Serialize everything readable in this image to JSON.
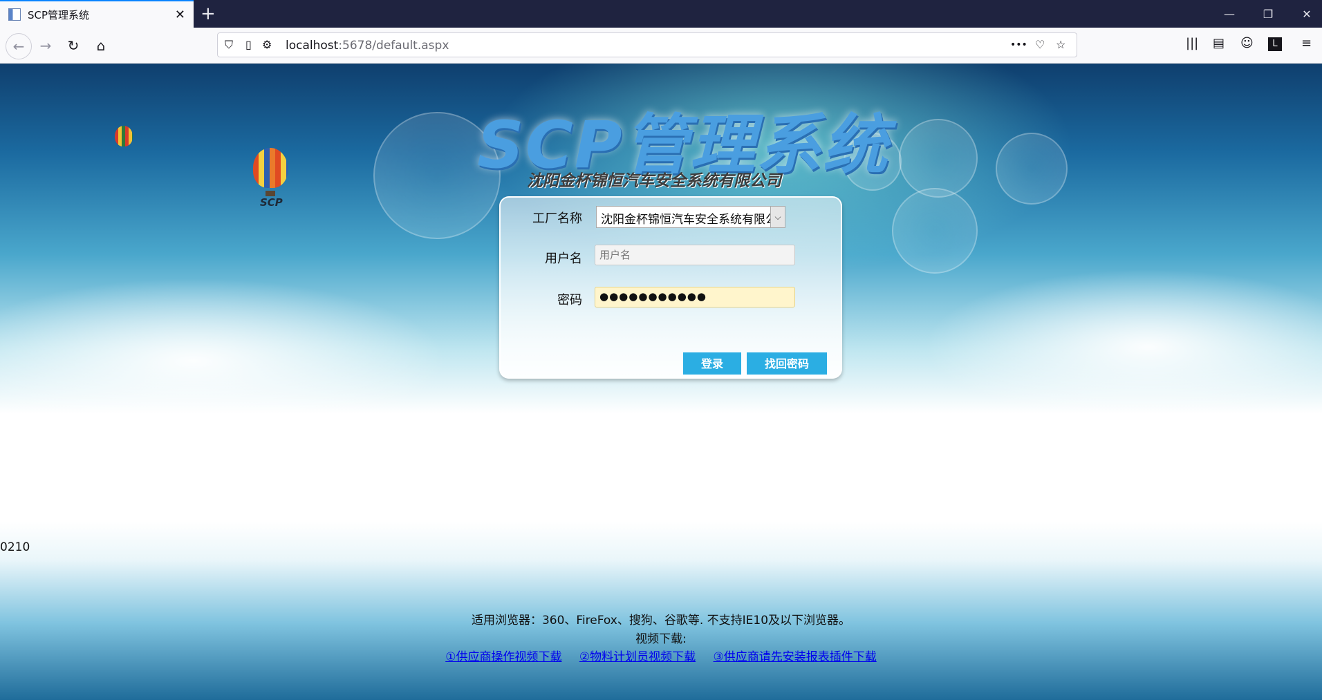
{
  "browser": {
    "tab_title": "SCP管理系统",
    "url_host": "localhost",
    "url_rest": ":5678/default.aspx",
    "new_tab": "+",
    "tab_close": "✕",
    "menu_dots": "•••"
  },
  "page": {
    "logo_text": "SCP管理系统",
    "company_name": "沈阳金杯锦恒汽车安全系统有限公司",
    "balloon_text": "SCP"
  },
  "login": {
    "factory_label": "工厂名称",
    "factory_selected": "沈阳金杯锦恒汽车安全系统有限公司",
    "username_label": "用户名",
    "username_placeholder": "用户名",
    "password_label": "密码",
    "password_mask": "●●●●●●●●●●●",
    "login_button": "登录",
    "recover_button": "找回密码"
  },
  "version": "0210",
  "footer": {
    "browsers_note": "适用浏览器：360、FireFox、搜狗、谷歌等. 不支持IE10及以下浏览器。",
    "video_label": "视频下载:",
    "links": [
      "①供应商操作视频下载",
      "②物料计划员视频下载",
      "③供应商请先安装报表插件下载"
    ]
  }
}
